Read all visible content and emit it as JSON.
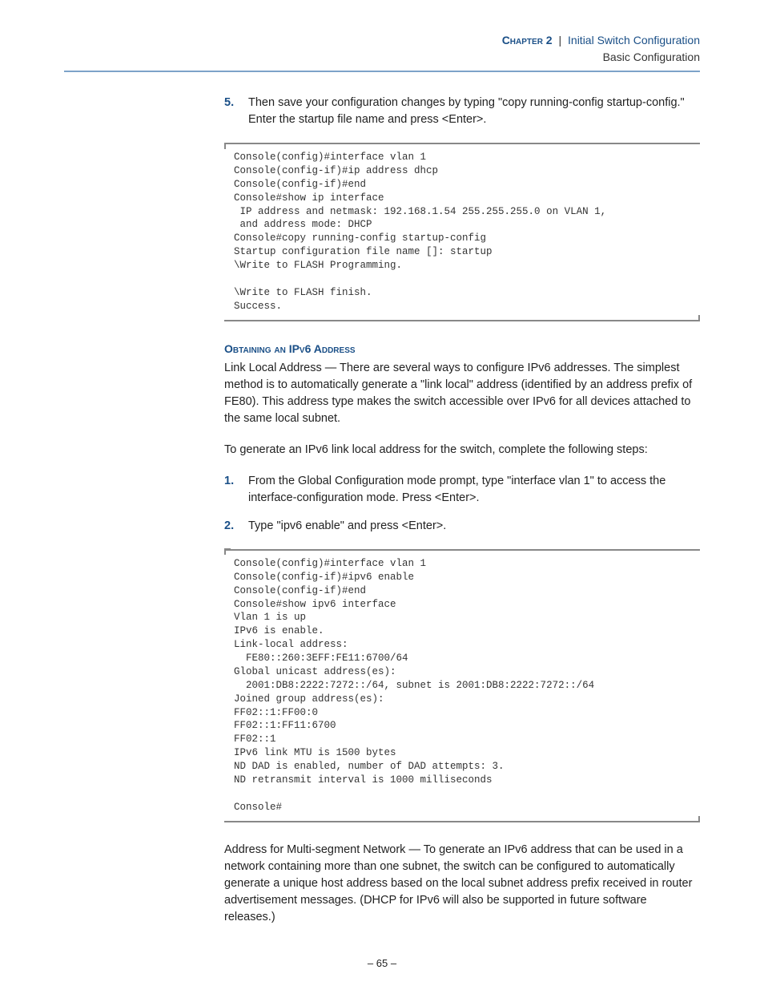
{
  "header": {
    "chapter": "Chapter 2",
    "separator": "|",
    "chapter_title": "Initial Switch Configuration",
    "subtitle": "Basic Configuration"
  },
  "step5": {
    "num": "5.",
    "text": "Then save your configuration changes by typing \"copy running-config startup-config.\" Enter the startup file name and press <Enter>."
  },
  "code1": "Console(config)#interface vlan 1\nConsole(config-if)#ip address dhcp\nConsole(config-if)#end\nConsole#show ip interface\n IP address and netmask: 192.168.1.54 255.255.255.0 on VLAN 1,\n and address mode: DHCP\nConsole#copy running-config startup-config\nStartup configuration file name []: startup\n\\Write to FLASH Programming.\n\n\\Write to FLASH finish.\nSuccess.",
  "section": {
    "heading": "Obtaining an IPv6 Address",
    "para1": "Link Local Address — There are several ways to configure IPv6 addresses. The simplest method is to automatically generate a \"link local\" address (identified by an address prefix of FE80). This address type makes the switch accessible over IPv6 for all devices attached to the same local subnet.",
    "para2": "To generate an IPv6 link local address for the switch, complete the following steps:"
  },
  "steps_b": {
    "s1": {
      "num": "1.",
      "text": "From the Global Configuration mode prompt, type \"interface vlan 1\" to access the interface-configuration mode. Press <Enter>."
    },
    "s2": {
      "num": "2.",
      "text": "Type \"ipv6 enable\" and press <Enter>."
    }
  },
  "code2": "Console(config)#interface vlan 1\nConsole(config-if)#ipv6 enable\nConsole(config-if)#end\nConsole#show ipv6 interface\nVlan 1 is up\nIPv6 is enable.\nLink-local address:\n  FE80::260:3EFF:FE11:6700/64\nGlobal unicast address(es):\n  2001:DB8:2222:7272::/64, subnet is 2001:DB8:2222:7272::/64\nJoined group address(es):\nFF02::1:FF00:0\nFF02::1:FF11:6700\nFF02::1\nIPv6 link MTU is 1500 bytes\nND DAD is enabled, number of DAD attempts: 3.\nND retransmit interval is 1000 milliseconds\n\nConsole#",
  "para_after": "Address for Multi-segment Network — To generate an IPv6 address that can be used in a network containing more than one subnet, the switch can be configured to automatically generate a unique host address based on the local subnet address prefix received in router advertisement messages. (DHCP for IPv6 will also be supported in future software releases.)",
  "footer": "– 65 –"
}
